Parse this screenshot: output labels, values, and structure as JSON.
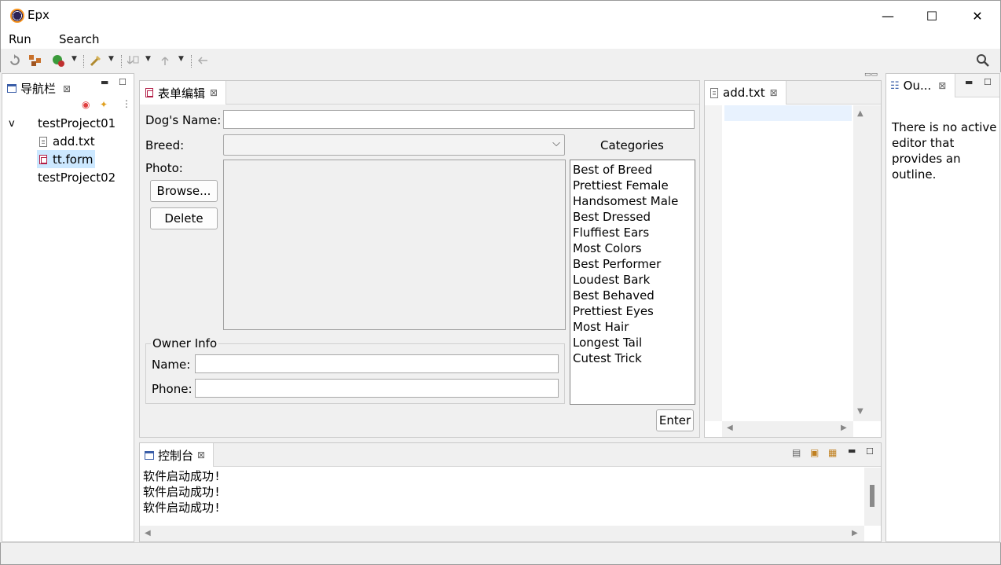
{
  "window": {
    "title": "Epx",
    "minimize": "—",
    "maximize": "☐",
    "close": "✕"
  },
  "menu": {
    "run": "Run",
    "search": "Search"
  },
  "navigator": {
    "tab_label": "导航栏",
    "tree": [
      {
        "label": "testProject01",
        "expanded": true
      },
      {
        "label": "add.txt"
      },
      {
        "label": "tt.form",
        "selected": true
      },
      {
        "label": "testProject02"
      }
    ],
    "expand_glyph": "v"
  },
  "form_editor": {
    "tab_label": "表单编辑",
    "dogs_name_label": "Dog's Name:",
    "dogs_name_value": "",
    "breed_label": "Breed:",
    "breed_value": "",
    "categories_label": "Categories",
    "photo_label": "Photo:",
    "browse_button": "Browse...",
    "delete_button": "Delete",
    "categories": [
      "Best of Breed",
      "Prettiest Female",
      "Handsomest Male",
      "Best Dressed",
      "Fluffiest Ears",
      "Most Colors",
      "Best Performer",
      "Loudest Bark",
      "Best Behaved",
      "Prettiest Eyes",
      "Most Hair",
      "Longest Tail",
      "Cutest Trick"
    ],
    "owner_info_legend": "Owner Info",
    "owner_name_label": "Name:",
    "owner_name_value": "",
    "owner_phone_label": "Phone:",
    "owner_phone_value": "",
    "enter_button": "Enter"
  },
  "text_editor": {
    "tab_label": "add.txt"
  },
  "outline": {
    "tab_label": "Ou...",
    "message": "There is no active editor that provides an outline."
  },
  "console": {
    "tab_label": "控制台",
    "lines": [
      "软件启动成功!",
      "软件启动成功!",
      "软件启动成功!"
    ]
  },
  "icons": {
    "search": "search-icon",
    "close_tab": "close-icon",
    "minimize_view": "minimize-icon",
    "maximize_view": "maximize-icon"
  },
  "colors": {
    "selection": "#cce8ff",
    "form_icon": "#b21e46",
    "editor_line_highlight": "#e8f2fe"
  }
}
